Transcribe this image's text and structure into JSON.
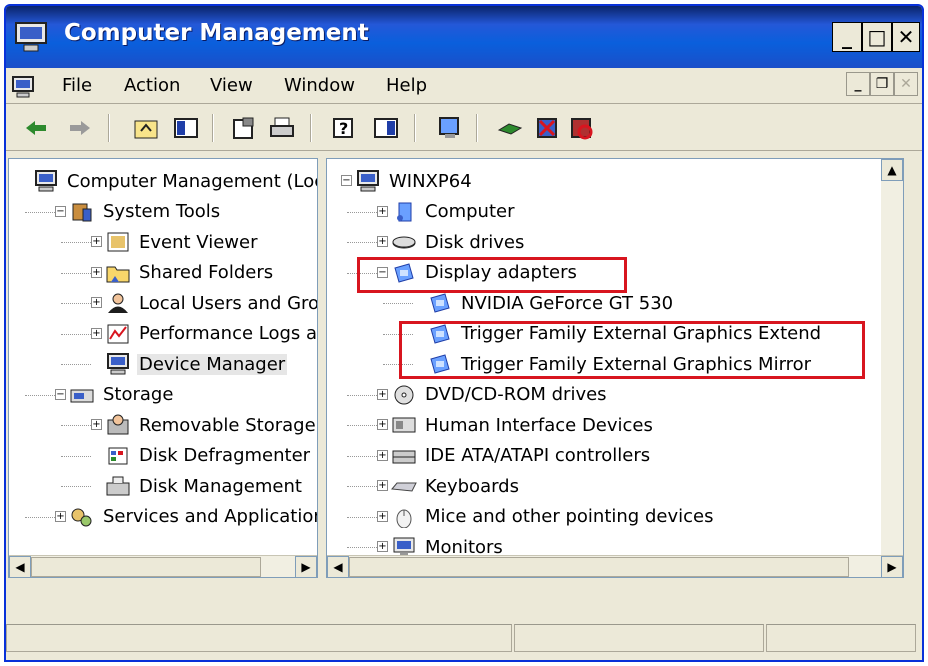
{
  "window": {
    "title": "Computer Management"
  },
  "menu": [
    "File",
    "Action",
    "View",
    "Window",
    "Help"
  ],
  "left_tree": [
    {
      "label": "Computer Management (Loc",
      "level": 0,
      "icon": "computer-management-icon",
      "expander": ""
    },
    {
      "label": "System Tools",
      "level": 1,
      "icon": "system-tools-icon",
      "expander": "−"
    },
    {
      "label": "Event Viewer",
      "level": 2,
      "icon": "event-viewer-icon",
      "expander": "+"
    },
    {
      "label": "Shared Folders",
      "level": 2,
      "icon": "shared-folders-icon",
      "expander": "+"
    },
    {
      "label": "Local Users and Gro",
      "level": 2,
      "icon": "local-users-icon",
      "expander": "+"
    },
    {
      "label": "Performance Logs a",
      "level": 2,
      "icon": "performance-logs-icon",
      "expander": "+"
    },
    {
      "label": "Device Manager",
      "level": 2,
      "icon": "device-manager-icon",
      "expander": "",
      "selected": true
    },
    {
      "label": "Storage",
      "level": 1,
      "icon": "storage-icon",
      "expander": "−"
    },
    {
      "label": "Removable Storage",
      "level": 2,
      "icon": "removable-storage-icon",
      "expander": "+"
    },
    {
      "label": "Disk Defragmenter",
      "level": 2,
      "icon": "disk-defragmenter-icon",
      "expander": ""
    },
    {
      "label": "Disk Management",
      "level": 2,
      "icon": "disk-management-icon",
      "expander": ""
    },
    {
      "label": "Services and Application",
      "level": 1,
      "icon": "services-icon",
      "expander": "+"
    }
  ],
  "right_tree": [
    {
      "label": "WINXP64",
      "level": 0,
      "icon": "computer-icon",
      "expander": "−"
    },
    {
      "label": "Computer",
      "level": 1,
      "icon": "computer-category-icon",
      "expander": "+"
    },
    {
      "label": "Disk drives",
      "level": 1,
      "icon": "disk-drive-icon",
      "expander": "+"
    },
    {
      "label": "Display adapters",
      "level": 1,
      "icon": "display-adapter-icon",
      "expander": "−"
    },
    {
      "label": "NVIDIA GeForce GT 530",
      "level": 2,
      "icon": "display-adapter-icon",
      "expander": ""
    },
    {
      "label": "Trigger Family External Graphics Extend",
      "level": 2,
      "icon": "display-adapter-icon",
      "expander": ""
    },
    {
      "label": "Trigger Family External Graphics Mirror",
      "level": 2,
      "icon": "display-adapter-icon",
      "expander": ""
    },
    {
      "label": "DVD/CD-ROM drives",
      "level": 1,
      "icon": "cdrom-icon",
      "expander": "+"
    },
    {
      "label": "Human Interface Devices",
      "level": 1,
      "icon": "hid-icon",
      "expander": "+"
    },
    {
      "label": "IDE ATA/ATAPI controllers",
      "level": 1,
      "icon": "ide-controller-icon",
      "expander": "+"
    },
    {
      "label": "Keyboards",
      "level": 1,
      "icon": "keyboard-icon",
      "expander": "+"
    },
    {
      "label": "Mice and other pointing devices",
      "level": 1,
      "icon": "mouse-icon",
      "expander": "+"
    },
    {
      "label": "Monitors",
      "level": 1,
      "icon": "monitor-icon",
      "expander": "+"
    }
  ],
  "colors": {
    "titlebar": "#0a5fdc",
    "highlight_box": "#d8151f"
  }
}
